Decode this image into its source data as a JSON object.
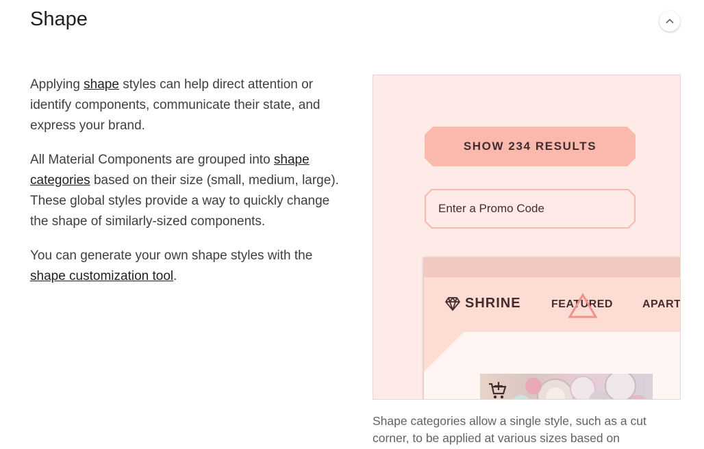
{
  "section": {
    "title": "Shape",
    "collapse_icon": "chevron-up-icon"
  },
  "paragraphs": {
    "p1": {
      "before": "Applying ",
      "link": "shape",
      "after": " styles can help direct attention or identify components, communicate their state, and express your brand."
    },
    "p2": {
      "before": "All Material Components are grouped into ",
      "link": "shape categories",
      "after": " based on their size (small, medium, large). These global styles provide a way to quickly change the shape of similarly-sized components."
    },
    "p3": {
      "before": "You can generate your own shape styles with the ",
      "link": "shape customization tool",
      "after": "."
    }
  },
  "figure": {
    "button_label": "SHOW 234 RESULTS",
    "promo_placeholder": "Enter a Promo Code",
    "brand": "SHRINE",
    "brand_icon": "diamond-icon",
    "nav_items": [
      "FEATURED",
      "APART"
    ],
    "cart_icon": "add-to-cart-icon",
    "colors": {
      "background": "#feeae6",
      "primary": "#fbb8ac",
      "on_primary": "#442c2e",
      "surface": "#fff6f4"
    }
  },
  "caption": "Shape categories allow a single style, such as a cut corner, to be applied at various sizes based on"
}
